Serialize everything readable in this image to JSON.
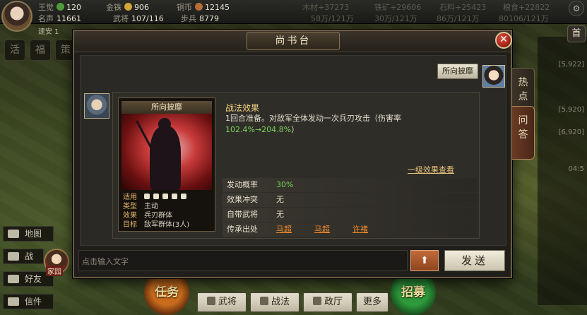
{
  "topbar": {
    "row1": [
      {
        "key": "王觉",
        "value": "120",
        "icon": "green-gem-icon",
        "color": "#4f9b3c"
      },
      {
        "key": "金铢",
        "value": "906",
        "icon": "gold-coin-icon",
        "color": "#d2a53a"
      },
      {
        "key": "铜币",
        "value": "12145",
        "icon": "copper-coin-icon",
        "color": "#b86d3a"
      }
    ],
    "row2": [
      {
        "key": "名声",
        "value": "11661"
      },
      {
        "key": "武将",
        "value": "107/116"
      },
      {
        "key": "步兵",
        "value": "8779"
      }
    ],
    "resources_row1": [
      {
        "label": "木材+37273"
      },
      {
        "label": "铁矿+29606"
      },
      {
        "label": "石料+25423"
      },
      {
        "label": "粮食+22822"
      }
    ],
    "resources_row2": [
      {
        "label": "58万/121万"
      },
      {
        "label": "30万/121万"
      },
      {
        "label": "86万/121万"
      },
      {
        "label": "80106/121万"
      }
    ],
    "season": "建安 1"
  },
  "left_side": {
    "pills": [
      "活",
      "福",
      "策"
    ],
    "menu": [
      {
        "label": "地图",
        "icon": "map-icon"
      },
      {
        "label": "战",
        "icon": "battle-icon"
      },
      {
        "label": "好友",
        "icon": "friends-icon"
      },
      {
        "label": "信件",
        "icon": "mail-icon"
      }
    ],
    "home_label": "家园"
  },
  "right_side": {
    "leader_tab": "首",
    "labels": [
      "[5,922]",
      "[5,920]",
      "[6,920]",
      "04:5"
    ]
  },
  "modal": {
    "title": "尚书台",
    "close_symbol": "✕",
    "adviser_name": "所向披靡",
    "tabs": [
      {
        "label": "热\n点",
        "active": false
      },
      {
        "label": "问\n答",
        "active": true
      }
    ],
    "card": {
      "name": "所向披靡",
      "meta": [
        {
          "label": "适用",
          "value": ""
        },
        {
          "label": "类型",
          "value": "主动"
        },
        {
          "label": "效果",
          "value": "兵刃群体"
        },
        {
          "label": "目标",
          "value": "敌军群体(3人)"
        }
      ]
    },
    "effect_title": "战法效果",
    "effect_desc_main": "1回合准备。对敌军全体发动一次兵刃攻击（伤害率",
    "effect_desc_rate": "102.4%→204.8%",
    "effect_desc_end": "）",
    "view_link": "一级效果查看",
    "info": {
      "rate_label": "发动概率",
      "rate_value": "30%",
      "conflict_label": "效果冲突",
      "conflict_value": "无",
      "own_label": "自带武将",
      "own_value": "无",
      "heir_label": "传承出处",
      "heirs": [
        "马超",
        "马超",
        "许褚"
      ]
    },
    "input_placeholder": "点击输入文字",
    "up_symbol": "⬆",
    "send_label": "发送"
  },
  "bottom": {
    "task_label": "任务",
    "recruit_label": "招募",
    "tabs": [
      {
        "label": "武将"
      },
      {
        "label": "战法"
      },
      {
        "label": "政厅"
      },
      {
        "label": "更多"
      }
    ]
  }
}
